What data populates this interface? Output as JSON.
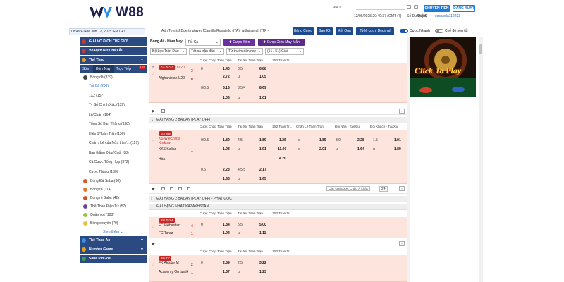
{
  "brand": {
    "name": "W88"
  },
  "header": {
    "currency": "VND",
    "datetime": "12/06/2025 20:49:37 (GMT+7)",
    "balance_label": "Số Dư/Điểm",
    "balance_value": "Quỹ $",
    "username": "cosacola112233",
    "deposit_label": "CHUYỂN TIỀN",
    "logout_label": "ĐĂNG XUẤT"
  },
  "toolbar": {
    "date": "08:49:41PM Jun 12, 2025 GMT +7",
    "ticker": "Attn[Tennis] Due to player [Camilla Rosatello (ITA)] withdrawal, [ITF -",
    "btn_refresh": "Bảng Cược",
    "btn_statement": "Sao Kê",
    "btn_result": "Kết Quả",
    "btn_odds": "Tỷ lệ cược Decimal",
    "toggle_fast": "Cược Nhanh",
    "toggle_mode": "Chế độ nền tối"
  },
  "sidebar": {
    "top_items": [
      "GIẢI VÔ ĐỊCH THẾ GIỚI ...",
      "Vô Địch Nữ Châu Âu"
    ],
    "sports_title": "Thể Thao",
    "tabs": [
      {
        "label": "Sớm"
      },
      {
        "label": "Hôm Nay"
      },
      {
        "label": "Trực Tiếp"
      }
    ],
    "live_count": "127",
    "football_label": "Bóng đá (339)",
    "sub_items": [
      "Tất Cả (209)",
      "1X2 (157)",
      "Tỷ Số Chính Xác (139)",
      "Lẻ/Chẵn (164)",
      "Tổng Số Bàn Thắng (138)",
      "Hiệp 1/Toàn Trận (130)",
      "Chẵn / Lẻ của Nửa trận/... (127)",
      "Bàn thắng Đầu/ Cuối (88)",
      "Cá Cược Tổng Hợp (372)",
      "Cược Thắng (130)"
    ],
    "sports": [
      "Bóng Đá Saba (60)",
      "Bóng rổ (114)",
      "Bóng rổ Saba (42)",
      "Thể Thao Điện Tử (57)",
      "Quần vợt (108)",
      "Bóng chuyền (70)"
    ],
    "more_label": "Xem thêm",
    "bottom_items": [
      "Thể Thao Ảo",
      "Number Game",
      "Saba PinGoal"
    ]
  },
  "filters": {
    "sport_title": "Bóng đá / Hôm Nay",
    "all": "Tất Cả",
    "mix": "Cược Xiên",
    "mix_random": "Cược Xiên May Mắn",
    "league_filter": "Bộ Lọc Trận Đấu",
    "bet_type": "Tất cả trận đấu",
    "sort": "Từ trước đến nay",
    "page": "(51 / 51) Giải"
  },
  "cols": {
    "hdp": "Cược Chấp Toàn Trận",
    "ou": "Tài Xỉu Toàn Trận",
    "x12": "1X2 Toàn Tr...",
    "oe": "Chẵn Lẻ Toàn Trận",
    "home_ou": "Đội Nhà - Tài/Xỉu",
    "away_ou": "Đội Khách - Tài/Xỉu",
    "u": "u"
  },
  "leagues": [
    {
      "name": "GIẢI HẠNG 2 BA LAN (PLAY OFF)"
    },
    {
      "name": "GIẢI HẠNG 2 BA LAN (PLAY OFF) - PHẠT GÓC"
    },
    {
      "name": "GIẢI HẠNG NHẤT KAZAKHSTAN"
    }
  ],
  "match1": {
    "live": "2H 46'+4",
    "home": "Kyrgyzstan U 20",
    "away": "Afghanistan U20",
    "s1": "3",
    "s2": "0",
    "r1": [
      "0",
      "1.40",
      "3.5",
      "6.88",
      "u"
    ],
    "r2": [
      "",
      "2.72",
      "u",
      "1.05",
      ""
    ],
    "r3": [
      "0/0.5",
      "5.16",
      "3.5/4",
      "8.69",
      ""
    ],
    "r4": [
      "",
      "1.06",
      "u",
      "1.01",
      ""
    ]
  },
  "match2": {
    "live": "Ð.Time",
    "home": "KS Wieczysta Krakow",
    "away": "KKS Kalisz",
    "draw": "Hòa",
    "s1": "1",
    "s2": "1",
    "a": [
      "0/0.5",
      "1.89",
      "4.5",
      "1.89",
      "1.26",
      "o",
      "1.85",
      "3.0",
      "2.28",
      "1.5",
      "1.91"
    ],
    "b": [
      "",
      "1.93",
      "u",
      "1.91",
      "11.00",
      "e",
      "2.01",
      "u",
      "1.64",
      "u",
      "1.89"
    ],
    "c": [
      "4.20"
    ],
    "d": [
      "0.5",
      "2.23",
      "4.5/5",
      "2.17"
    ],
    "e": [
      "",
      "1.63",
      "u",
      "1.65"
    ],
    "type_label": "Các loại cược Châu Á khác",
    "page_label": "24"
  },
  "match3": {
    "live": "2H 45'+4",
    "home": "FC Ekibastuz",
    "away": "FC Taraz",
    "s1": "4",
    "s2": "1",
    "a": [
      "0",
      "1.84",
      "5.5",
      "5.00"
    ],
    "b": [
      "",
      "1.94",
      "u",
      "1.11"
    ]
  },
  "match4": {
    "live": "2H 43'",
    "home": "FK Aktobe M",
    "away": "Academy On tustik",
    "s1": "2",
    "s2": "1",
    "a": [
      "0",
      "2.69",
      "2.5",
      "3.22"
    ],
    "b": [
      "",
      "1.37",
      "u",
      "1.23"
    ]
  },
  "banner_text": "Click To Play",
  "colors": {
    "brand": "#1e1f4b",
    "accent": "#1f7ad6",
    "nav": "#2c4a82",
    "row": "#fde4dc",
    "live": "#c62828"
  }
}
